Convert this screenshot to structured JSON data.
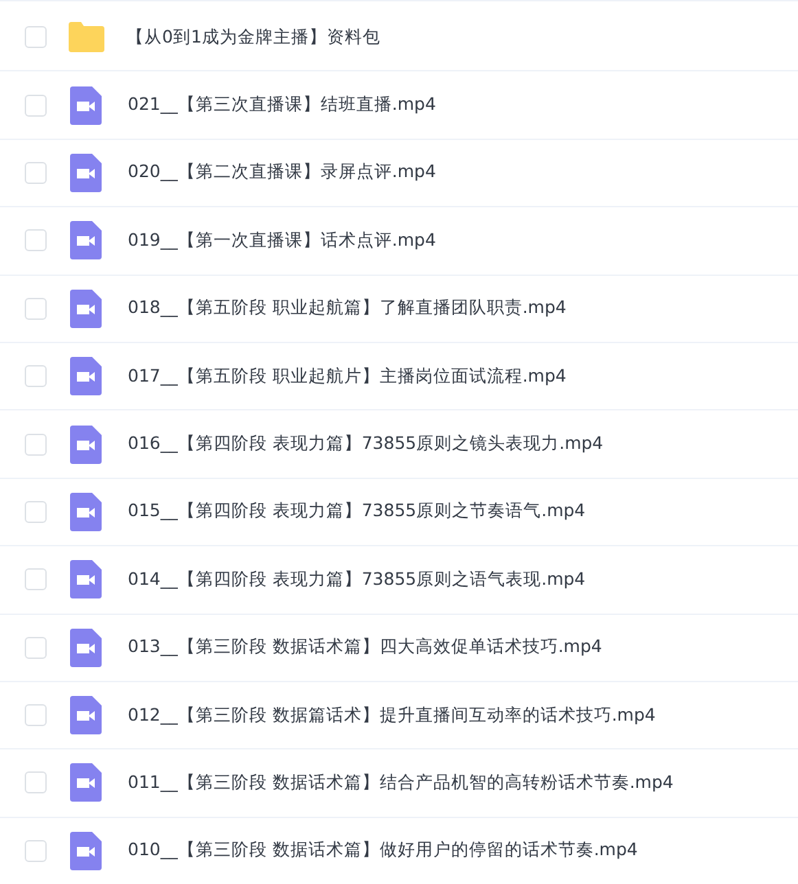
{
  "files": [
    {
      "kind": "folder",
      "name": "【从0到1成为金牌主播】资料包",
      "checked": false
    },
    {
      "kind": "video",
      "name": "021__【第三次直播课】结班直播.mp4",
      "checked": false
    },
    {
      "kind": "video",
      "name": "020__【第二次直播课】录屏点评.mp4",
      "checked": false
    },
    {
      "kind": "video",
      "name": "019__【第一次直播课】话术点评.mp4",
      "checked": false
    },
    {
      "kind": "video",
      "name": "018__【第五阶段 职业起航篇】了解直播团队职责.mp4",
      "checked": false
    },
    {
      "kind": "video",
      "name": "017__【第五阶段 职业起航片】主播岗位面试流程.mp4",
      "checked": false
    },
    {
      "kind": "video",
      "name": "016__【第四阶段 表现力篇】73855原则之镜头表现力.mp4",
      "checked": false
    },
    {
      "kind": "video",
      "name": "015__【第四阶段 表现力篇】73855原则之节奏语气.mp4",
      "checked": false
    },
    {
      "kind": "video",
      "name": "014__【第四阶段 表现力篇】73855原则之语气表现.mp4",
      "checked": false
    },
    {
      "kind": "video",
      "name": "013__【第三阶段 数据话术篇】四大高效促单话术技巧.mp4",
      "checked": false
    },
    {
      "kind": "video",
      "name": "012__【第三阶段 数据篇话术】提升直播间互动率的话术技巧.mp4",
      "checked": false
    },
    {
      "kind": "video",
      "name": "011__【第三阶段 数据话术篇】结合产品机智的高转粉话术节奏.mp4",
      "checked": false
    },
    {
      "kind": "video",
      "name": "010__【第三阶段 数据话术篇】做好用户的停留的话术节奏.mp4",
      "checked": false
    }
  ]
}
